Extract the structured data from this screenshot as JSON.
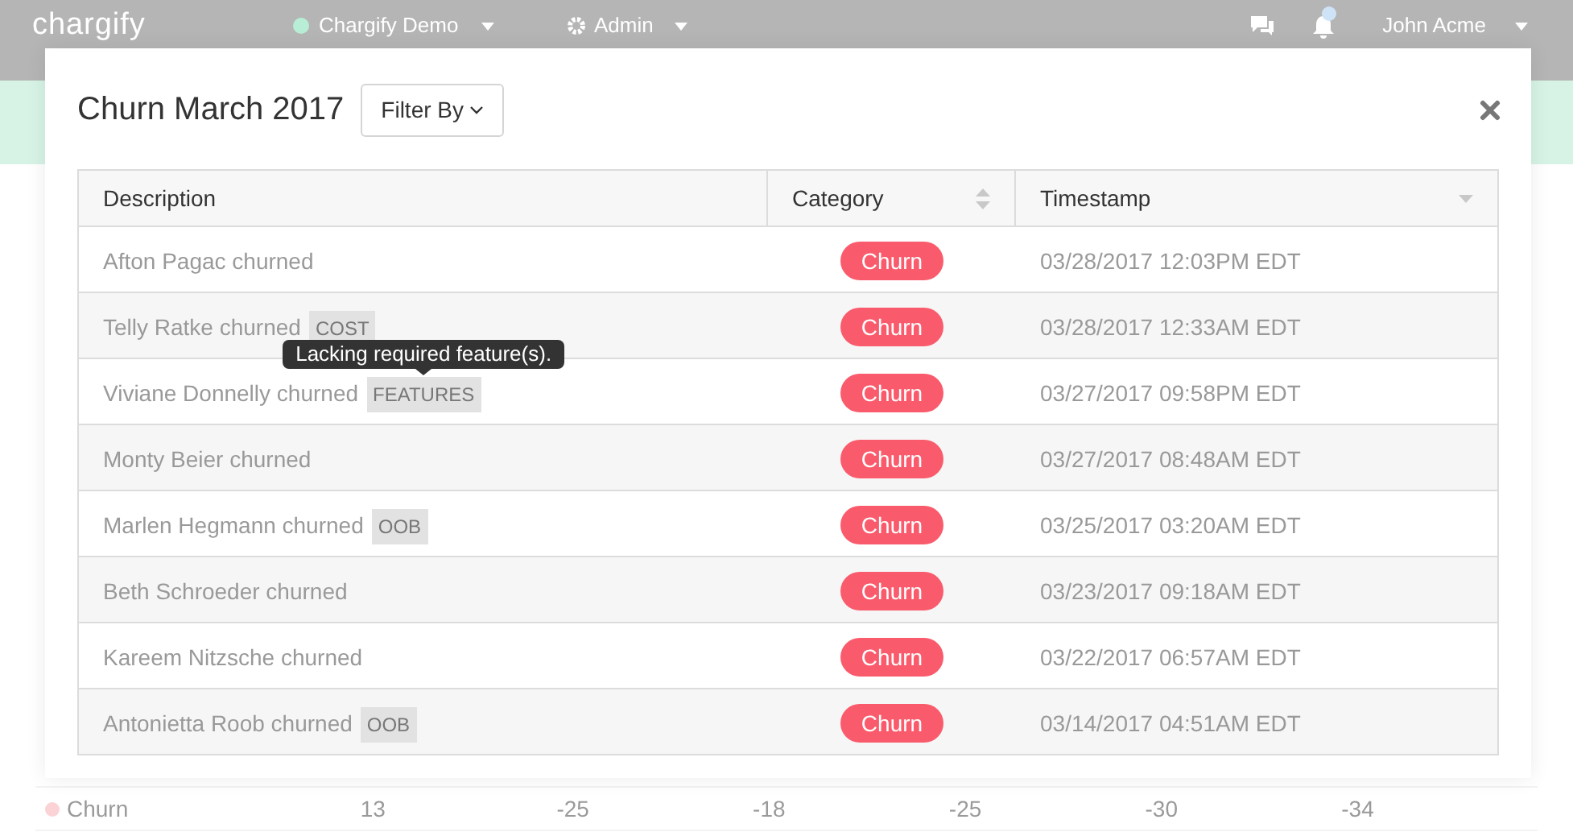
{
  "navbar": {
    "logo": "chargify",
    "site": {
      "label": "Chargify Demo",
      "color": "#b8eed6"
    },
    "admin": "Admin",
    "user": "John Acme",
    "notification_dot": true
  },
  "background_row": {
    "label": "Churn",
    "color": "#fbd3d6",
    "values": [
      "13",
      "-25",
      "-18",
      "-25",
      "-30",
      "-34"
    ]
  },
  "modal": {
    "title": "Churn March 2017",
    "filter_button": "Filter By",
    "table": {
      "columns": [
        {
          "label": "Description",
          "kind": "plain"
        },
        {
          "label": "Category",
          "kind": "sortable"
        },
        {
          "label": "Timestamp",
          "kind": "descending"
        }
      ],
      "rows": [
        {
          "description": "Afton Pagac churned",
          "category": "Churn",
          "timestamp": "03/28/2017 12:03PM EDT"
        },
        {
          "description": "Telly Ratke churned",
          "tag": "COST",
          "category": "Churn",
          "timestamp": "03/28/2017 12:33AM EDT"
        },
        {
          "description": "Viviane Donnelly churned",
          "tag": "FEATURES",
          "tooltip": "Lacking required feature(s).",
          "category": "Churn",
          "timestamp": "03/27/2017 09:58PM EDT"
        },
        {
          "description": "Monty Beier churned",
          "category": "Churn",
          "timestamp": "03/27/2017 08:48AM EDT"
        },
        {
          "description": "Marlen Hegmann churned",
          "tag": "OOB",
          "category": "Churn",
          "timestamp": "03/25/2017 03:20AM EDT"
        },
        {
          "description": "Beth Schroeder churned",
          "category": "Churn",
          "timestamp": "03/23/2017 09:18AM EDT"
        },
        {
          "description": "Kareem Nitzsche churned",
          "category": "Churn",
          "timestamp": "03/22/2017 06:57AM EDT"
        },
        {
          "description": "Antonietta Roob churned",
          "tag": "OOB",
          "category": "Churn",
          "timestamp": "03/14/2017 04:51AM EDT"
        }
      ]
    }
  }
}
